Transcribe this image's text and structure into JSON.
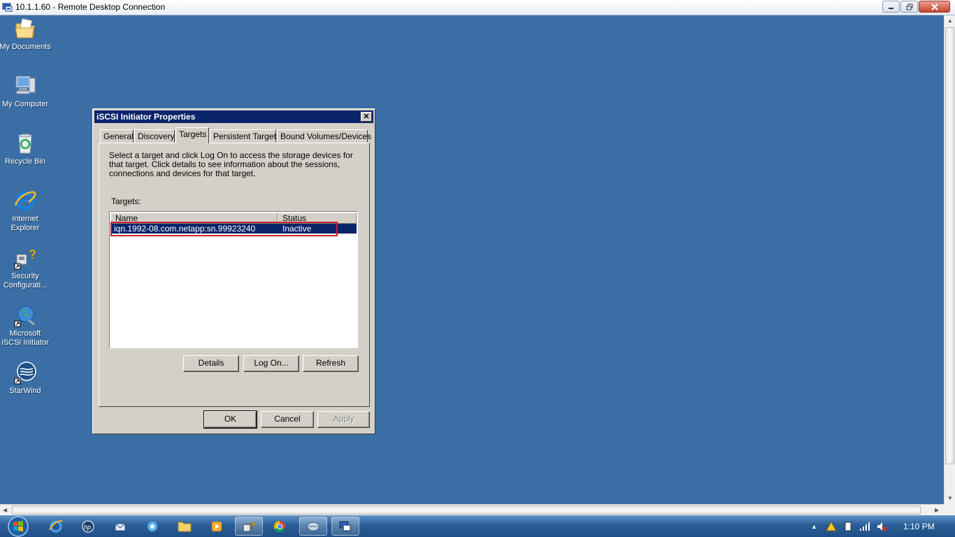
{
  "rdp_window": {
    "title": "10.1.1.60 - Remote Desktop Connection"
  },
  "desktop_icons": [
    {
      "name": "my-documents",
      "label": "My Documents"
    },
    {
      "name": "my-computer",
      "label": "My Computer"
    },
    {
      "name": "recycle-bin",
      "label": "Recycle Bin"
    },
    {
      "name": "internet-explorer",
      "label": "Internet Explorer",
      "line1": "Internet",
      "line2": "Explorer"
    },
    {
      "name": "security-configuration",
      "line1": "Security",
      "line2": "Configurati..."
    },
    {
      "name": "microsoft-iscsi-initiator",
      "line1": "Microsoft",
      "line2": "iSCSI Initiator"
    },
    {
      "name": "starwind",
      "label": "StarWind"
    }
  ],
  "dialog": {
    "title": "iSCSI Initiator Properties",
    "close_glyph": "✕",
    "tabs": [
      "General",
      "Discovery",
      "Targets",
      "Persistent Targets",
      "Bound Volumes/Devices"
    ],
    "active_tab": "Targets",
    "description": "Select a target and click Log On to access the storage devices for that target. Click details to see information about the sessions, connections and devices for that target.",
    "targets_label": "Targets:",
    "columns": [
      "Name",
      "Status"
    ],
    "rows": [
      {
        "name": "iqn.1992-08.com.netapp:sn.99923240",
        "status": "Inactive",
        "selected": true
      }
    ],
    "buttons": {
      "details": "Details",
      "log_on": "Log On...",
      "refresh": "Refresh"
    },
    "footer_buttons": {
      "ok": "OK",
      "cancel": "Cancel",
      "apply": "Apply"
    }
  },
  "taskbar": {
    "clock": "1:10 PM"
  },
  "colors": {
    "desktop": "#3a6ea5",
    "selection": "#0a246a",
    "highlight_box": "#d21f26"
  }
}
